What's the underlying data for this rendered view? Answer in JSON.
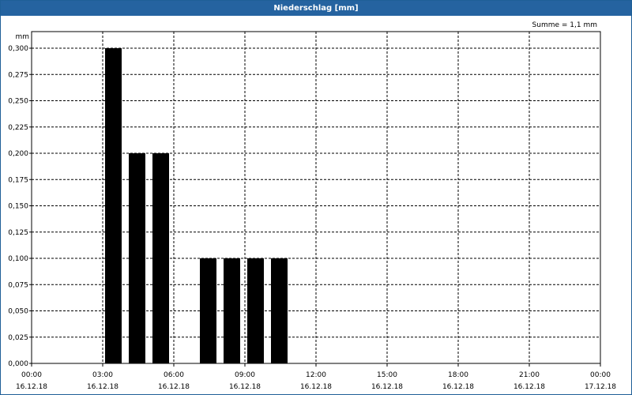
{
  "window": {
    "title": "Niederschlag [mm]",
    "accent_color": "#2563a0"
  },
  "summary": "Summe = 1,1 mm",
  "chart_data": {
    "type": "bar",
    "title": "Niederschlag [mm]",
    "ylabel": "mm",
    "xlabel": "",
    "ylim": [
      0,
      0.3
    ],
    "xlim_hours": [
      0,
      24
    ],
    "grid": true,
    "bar_color": "#000000",
    "y_ticks": [
      "0,000",
      "0,025",
      "0,050",
      "0,075",
      "0,100",
      "0,125",
      "0,150",
      "0,175",
      "0,200",
      "0,225",
      "0,250",
      "0,275",
      "0,300"
    ],
    "x_ticks": [
      {
        "time": "00:00",
        "date": "16.12.18"
      },
      {
        "time": "03:00",
        "date": "16.12.18"
      },
      {
        "time": "06:00",
        "date": "16.12.18"
      },
      {
        "time": "09:00",
        "date": "16.12.18"
      },
      {
        "time": "12:00",
        "date": "16.12.18"
      },
      {
        "time": "15:00",
        "date": "16.12.18"
      },
      {
        "time": "18:00",
        "date": "16.12.18"
      },
      {
        "time": "21:00",
        "date": "16.12.18"
      },
      {
        "time": "00:00",
        "date": "17.12.18"
      }
    ],
    "categories": [
      "03:00-04:00",
      "04:00-05:00",
      "05:00-06:00",
      "06:00-07:00",
      "07:00-08:00",
      "08:00-09:00",
      "09:00-10:00",
      "10:00-11:00"
    ],
    "values": [
      0.3,
      0.2,
      0.2,
      0.0,
      0.1,
      0.1,
      0.1,
      0.1
    ]
  }
}
